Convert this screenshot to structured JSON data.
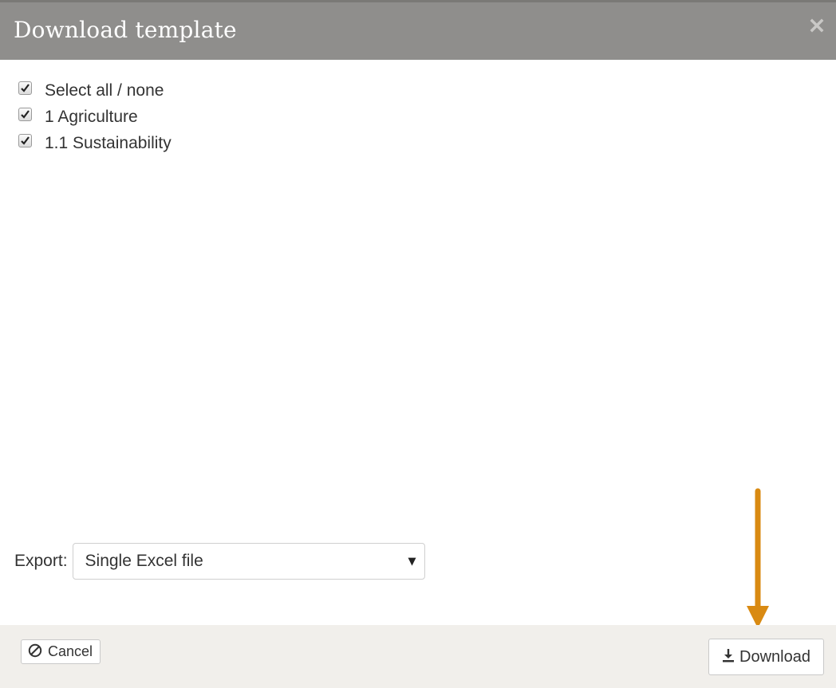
{
  "dialog": {
    "title": "Download template"
  },
  "checklist": [
    {
      "label": "Select all / none",
      "checked": true
    },
    {
      "label": "1 Agriculture",
      "checked": true
    },
    {
      "label": "1.1 Sustainability",
      "checked": true
    }
  ],
  "export": {
    "label": "Export:",
    "selected": "Single Excel file"
  },
  "footer": {
    "cancel_label": "Cancel",
    "download_label": "Download"
  },
  "colors": {
    "header_bg": "#8f8e8c",
    "footer_bg": "#f1efeb",
    "arrow": "#d98a12"
  },
  "icons": {
    "close": "close-icon",
    "cancel": "ban-icon",
    "download": "download-icon",
    "caret": "caret-down-icon"
  }
}
